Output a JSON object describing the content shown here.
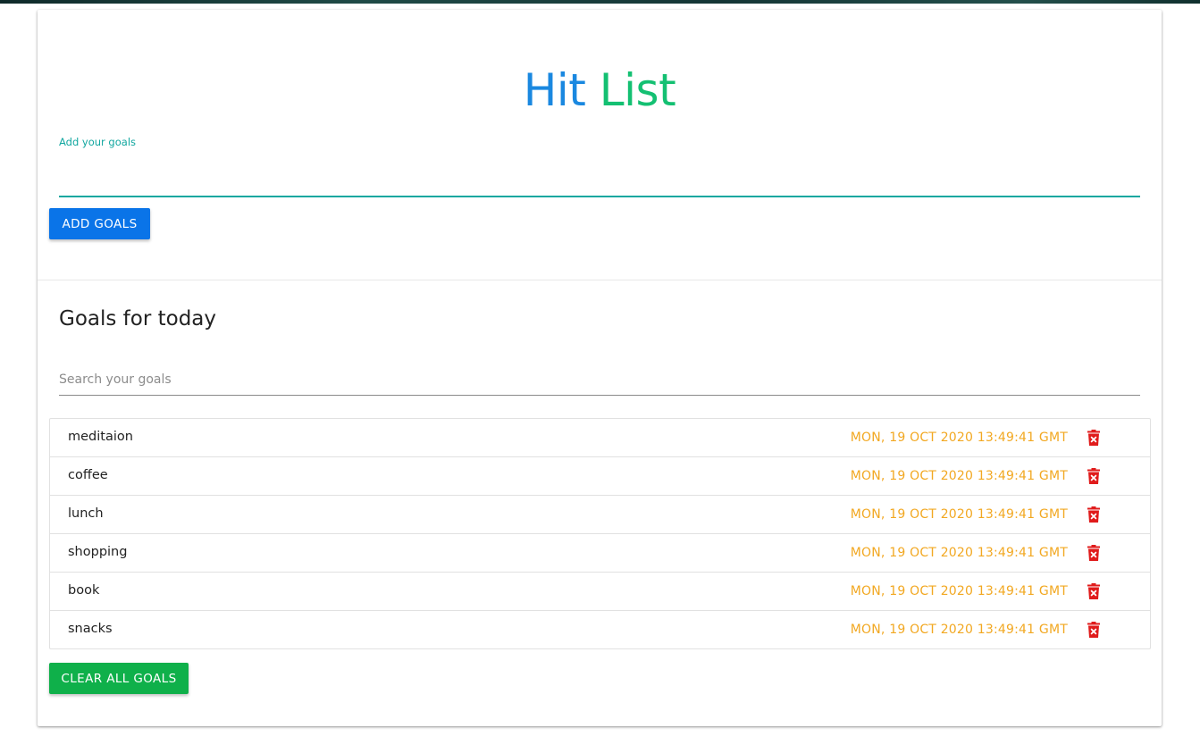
{
  "header": {
    "title_part1": "Hit",
    "title_part2": "List",
    "title_colors": {
      "part1": "#1a88e0",
      "part2": "#14c072"
    }
  },
  "add_form": {
    "label": "Add your goals",
    "value": "",
    "button_label": "ADD GOALS",
    "button_color": "#0a74e8",
    "accent_color": "#12a7a0"
  },
  "goals_section": {
    "title": "Goals for today",
    "search_placeholder": "Search your goals",
    "date_color": "#f2a822",
    "delete_icon": "trash-delete-icon",
    "delete_icon_color": "#e01b1b",
    "items": [
      {
        "text": "meditaion",
        "date": "MON, 19 OCT 2020 13:49:41 GMT"
      },
      {
        "text": "coffee",
        "date": "MON, 19 OCT 2020 13:49:41 GMT"
      },
      {
        "text": "lunch",
        "date": "MON, 19 OCT 2020 13:49:41 GMT"
      },
      {
        "text": "shopping",
        "date": "MON, 19 OCT 2020 13:49:41 GMT"
      },
      {
        "text": "book",
        "date": "MON, 19 OCT 2020 13:49:41 GMT"
      },
      {
        "text": "snacks",
        "date": "MON, 19 OCT 2020 13:49:41 GMT"
      }
    ],
    "clear_button_label": "CLEAR ALL GOALS",
    "clear_button_color": "#0fb04a"
  }
}
